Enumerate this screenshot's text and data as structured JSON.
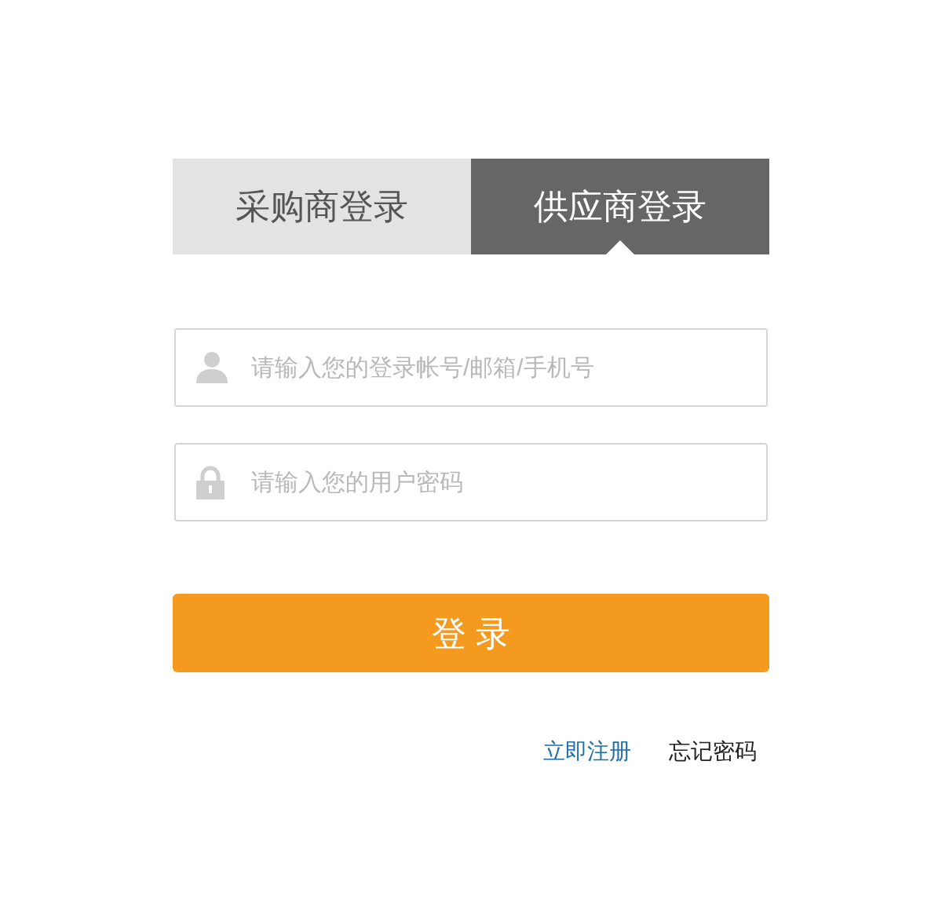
{
  "tabs": [
    {
      "label": "采购商登录",
      "selected": false
    },
    {
      "label": "供应商登录",
      "selected": true
    }
  ],
  "fields": [
    {
      "kind": "user",
      "placeholder": "请输入您的登录帐号/邮箱/手机号"
    },
    {
      "kind": "password",
      "placeholder": "请输入您的用户密码"
    }
  ],
  "login_button": "登 录",
  "links": [
    {
      "label": "立即注册",
      "kind": "primary"
    },
    {
      "label": "忘记密码",
      "kind": "plain"
    }
  ]
}
